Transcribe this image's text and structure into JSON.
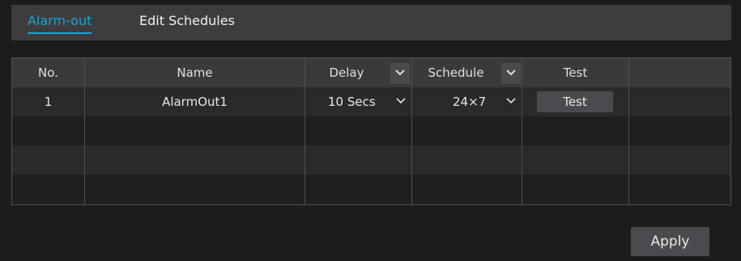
{
  "tabs": [
    {
      "label": "Alarm-out",
      "active": true
    },
    {
      "label": "Edit Schedules",
      "active": false
    }
  ],
  "table": {
    "headers": {
      "no": "No.",
      "name": "Name",
      "delay": "Delay",
      "schedule": "Schedule",
      "test": "Test"
    },
    "rows": [
      {
        "no": "1",
        "name": "AlarmOut1",
        "delay": "10 Secs",
        "schedule": "24×7",
        "test_label": "Test"
      }
    ]
  },
  "apply_label": "Apply",
  "colors": {
    "accent": "#1aa3d6",
    "background": "#1c1c1e",
    "tab_bar": "#3d3d40",
    "button": "#4b4b4f"
  },
  "icons": {
    "dropdown": "chevron-down-icon"
  }
}
